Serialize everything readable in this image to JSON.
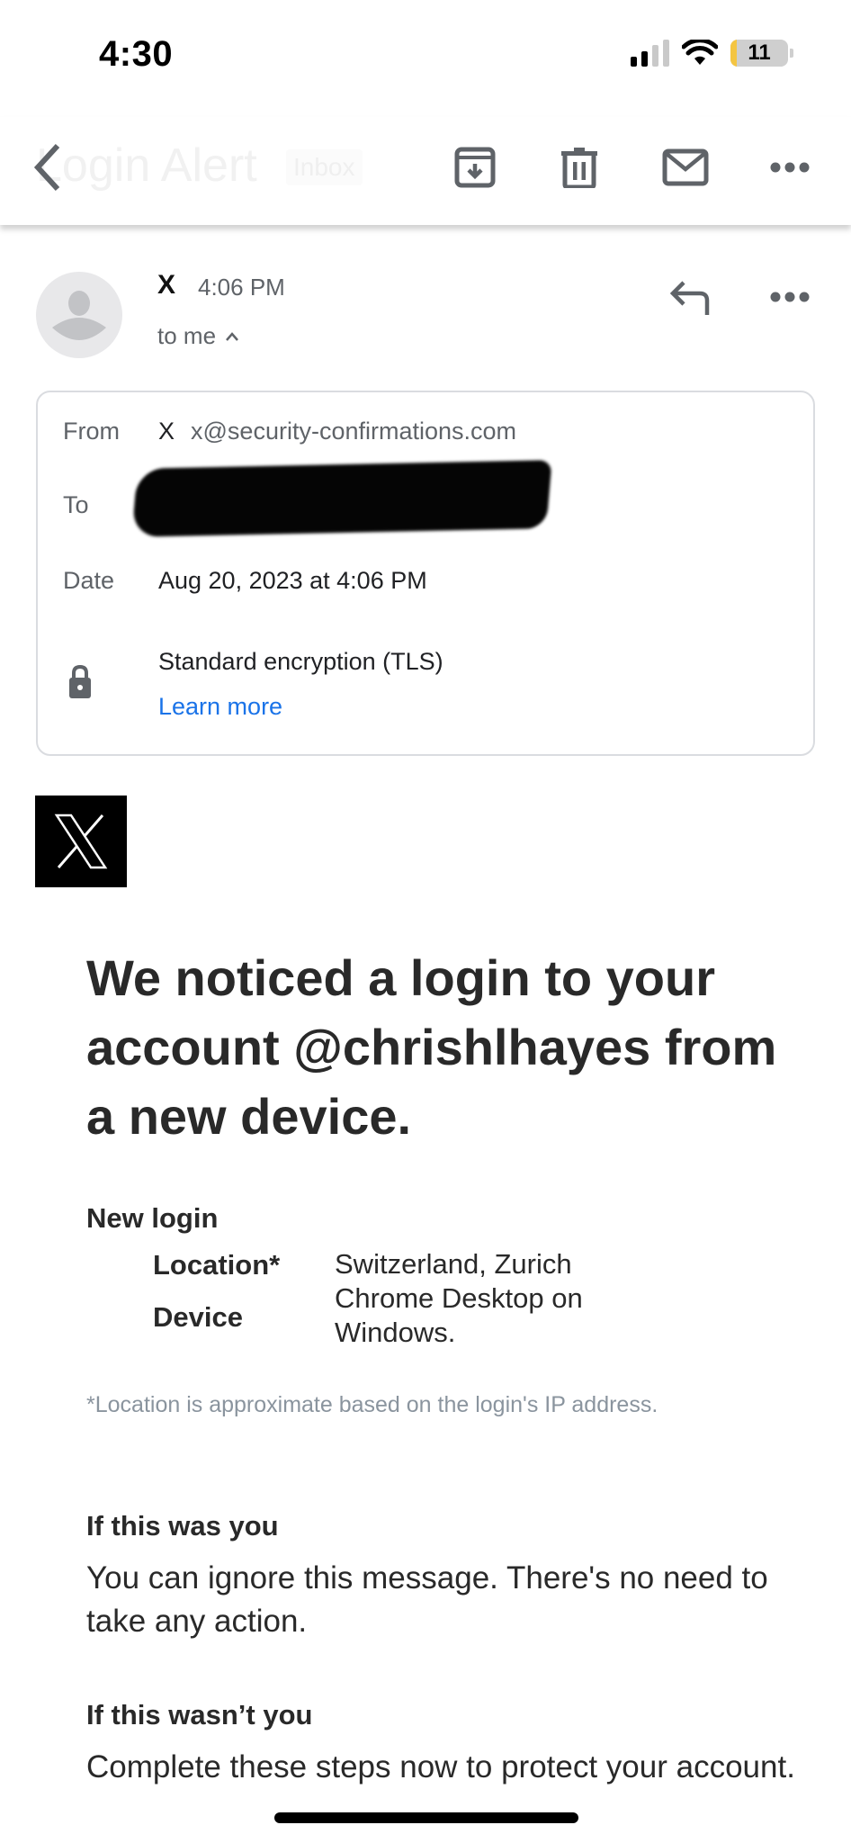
{
  "status_bar": {
    "time": "4:30",
    "signal_bars_filled": 2,
    "signal_bars_total": 4,
    "wifi": "wifi-icon",
    "battery_level": "11",
    "battery_low_power_color": "#f4c542"
  },
  "toolbar": {
    "back_icon": "chevron-left-icon",
    "title": "Login Alert",
    "label": "Inbox",
    "actions": [
      {
        "name": "archive",
        "icon": "archive-icon"
      },
      {
        "name": "delete",
        "icon": "trash-icon"
      },
      {
        "name": "mark-unread",
        "icon": "mail-icon"
      },
      {
        "name": "more",
        "icon": "more-horizontal-icon"
      }
    ]
  },
  "message_header": {
    "sender_name": "X",
    "time": "4:06 PM",
    "recipient_summary": "to me",
    "expand_icon": "chevron-up-icon",
    "reply_icon": "reply-icon",
    "more_icon": "more-horizontal-icon"
  },
  "details": {
    "from_label": "From",
    "from_name": "X",
    "from_email": "x@security-confirmations.com",
    "to_label": "To",
    "to_value": "[redacted]",
    "date_label": "Date",
    "date_value": "Aug 20, 2023 at 4:06 PM",
    "encryption_text": "Standard encryption (TLS)",
    "learn_more": "Learn more",
    "link_color": "#1a73e8"
  },
  "email_body": {
    "logo": "x-logo",
    "headline": "We noticed a login to your account @chrishlhayes from a new device.",
    "new_login_title": "New login",
    "login_details": [
      {
        "label": "Location*",
        "value": "Switzerland, Zurich"
      },
      {
        "label": "Device",
        "value": "Chrome Desktop on Windows."
      }
    ],
    "footnote": "*Location is approximate based on the login's IP address.",
    "section_you_title": "If this was you",
    "section_you_text": "You can ignore this message. There's no need to take any action.",
    "section_not_you_title": "If this wasn’t you",
    "section_not_you_text": "Complete these steps now to protect your account."
  }
}
